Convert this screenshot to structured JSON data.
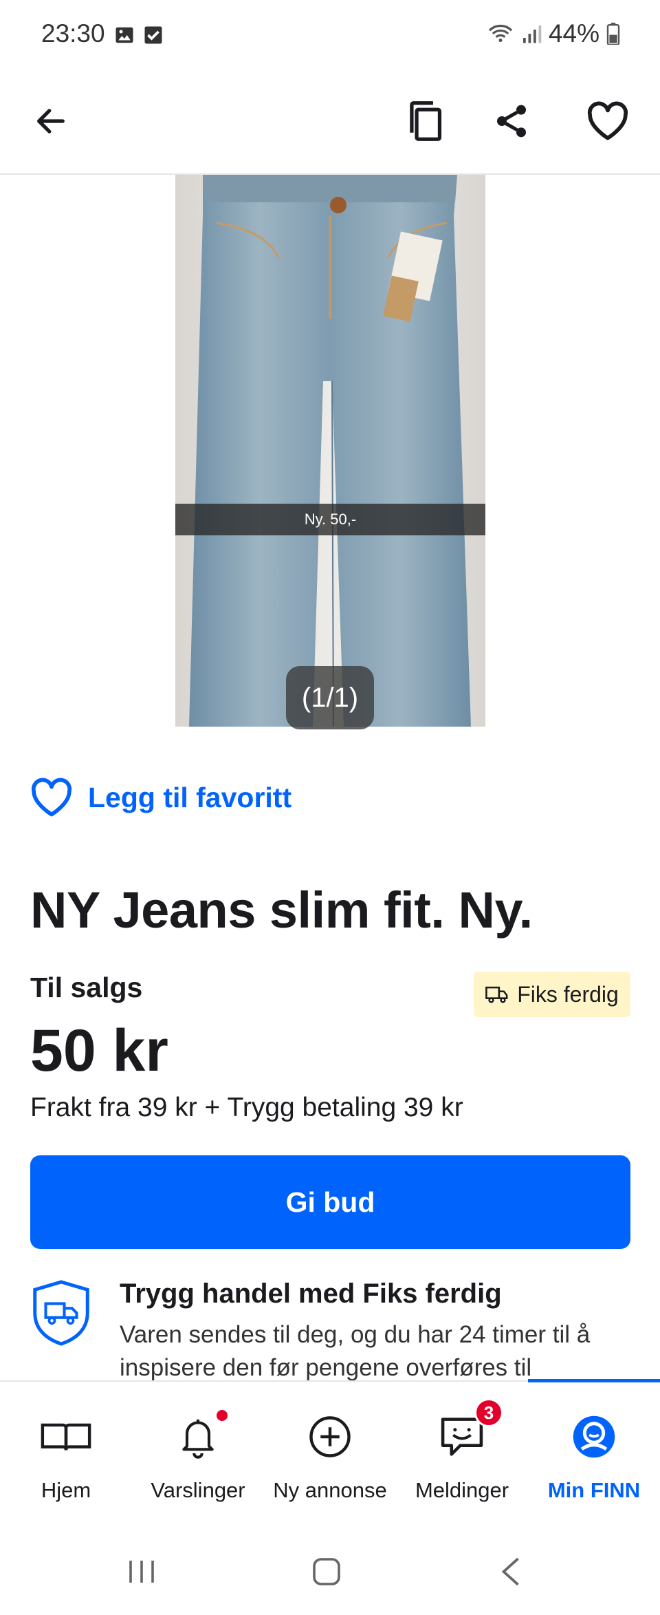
{
  "status_bar": {
    "time": "23:30",
    "battery": "44%",
    "left_icons": [
      "image-icon",
      "checkbox-icon"
    ],
    "right_icons": [
      "wifi-icon",
      "signal-icon",
      "battery-icon"
    ]
  },
  "app_bar": {
    "icons": [
      "back-arrow-icon",
      "copy-icon",
      "share-icon",
      "heart-icon"
    ]
  },
  "gallery": {
    "caption": "Ny. 50,-",
    "counter": "(1/1)"
  },
  "listing": {
    "favorite_label": "Legg til favoritt",
    "title": "NY Jeans slim fit. Ny.",
    "status": "Til salgs",
    "fiks_badge": "Fiks ferdig",
    "price": "50 kr",
    "shipping": "Frakt fra 39 kr + Trygg betaling 39 kr",
    "bid_button": "Gi bud",
    "safe_trade_title": "Trygg handel med Fiks ferdig",
    "safe_trade_text": "Varen sendes til deg, og du har 24 timer til å inspisere den før pengene overføres til"
  },
  "bottom_nav": {
    "items": [
      {
        "label": "Hjem",
        "icon": "book-icon"
      },
      {
        "label": "Varslinger",
        "icon": "bell-icon"
      },
      {
        "label": "Ny annonse",
        "icon": "plus-circle-icon"
      },
      {
        "label": "Meldinger",
        "icon": "message-icon",
        "badge": "3"
      },
      {
        "label": "Min FINN",
        "icon": "profile-icon"
      }
    ],
    "active_index": 4
  },
  "colors": {
    "accent": "#0063fb",
    "badge_red": "#e3002b",
    "fiks_bg": "#fff5c8"
  }
}
